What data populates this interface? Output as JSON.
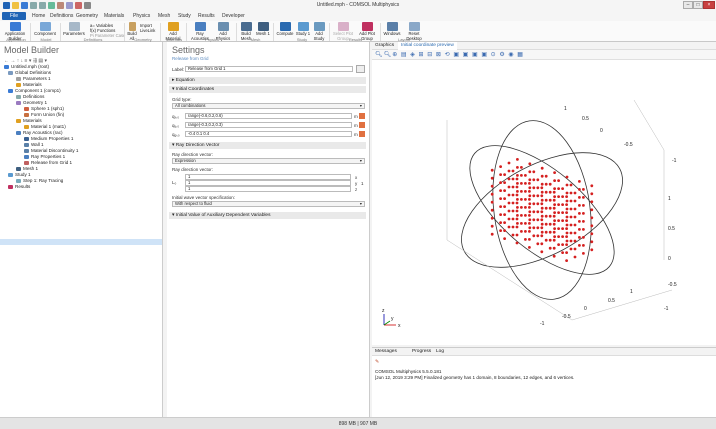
{
  "window": {
    "title": "Untitled.mph - COMSOL Multiphysics"
  },
  "menu": {
    "file": "File",
    "tabs": [
      "Home",
      "Definitions",
      "Geometry",
      "Materials",
      "Physics",
      "Mesh",
      "Study",
      "Results",
      "Developer"
    ]
  },
  "ribbon": {
    "application_builder": "Application Builder",
    "component": "Component",
    "parameters": "Parameters",
    "variables": "a= Variables",
    "functions": "f(x) Functions",
    "parameter_case": "Pi Parameter Case",
    "build_all": "Build All",
    "import": "Import",
    "livelink": "LiveLink",
    "add_material": "Add Material",
    "ray_acoustics": "Ray Acoustics",
    "add_physics": "Add Physics",
    "build_mesh": "Build Mesh",
    "mesh1": "Mesh 1",
    "compute": "Compute",
    "study1": "Study 1",
    "add_study": "Add Study",
    "select_plot_group": "Select Plot Group",
    "add_plot_group": "Add Plot Group",
    "windows": "Windows",
    "reset_desktop": "Reset Desktop",
    "groups": [
      "Application",
      "Model",
      "Definitions",
      "Geometry",
      "Materials",
      "Physics",
      "Mesh",
      "Study",
      "Results",
      "Layout"
    ]
  },
  "model_builder": {
    "title": "Model Builder",
    "tree": [
      "Untitled.mph (root)",
      "Global Definitions",
      "Parameters 1",
      "Materials",
      "Component 1 (comp1)",
      "Definitions",
      "Geometry 1",
      "Sphere 1 (sph1)",
      "Form Union (fin)",
      "Materials",
      "Material 1 (mat1)",
      "Ray Acoustics (rac)",
      "Medium Properties 1",
      "Wall 1",
      "Material Discontinuity 1",
      "Ray Properties 1",
      "Release from Grid 1",
      "Mesh 1",
      "Study 1",
      "Step 1: Ray Tracing",
      "Results"
    ]
  },
  "settings": {
    "title": "Settings",
    "subtitle": "Release from Grid",
    "label_caption": "Label:",
    "label_value": "Release from Grid 1",
    "equation": "Equation",
    "initial_coordinates": "Initial Coordinates",
    "grid_type_label": "Grid type:",
    "grid_type_value": "All combinations",
    "q_rows": [
      {
        "sym": "qₓ,₀",
        "val": "range(-0.6,0.2,0.6)",
        "unit": "m"
      },
      {
        "sym": "qᵧ,₀",
        "val": "range(-0.3,0.2,0.3)",
        "unit": "m"
      },
      {
        "sym": "qᵩ,₀",
        "val": "-0.4 0.1 0.4",
        "unit": "m"
      }
    ],
    "ray_direction": "Ray Direction Vector",
    "ray_direction_spec_label": "Ray direction vector:",
    "ray_direction_spec": "Expression",
    "ray_direction_label": "Ray direction vector:",
    "vector_symbol": "L₀",
    "vector_rows": [
      {
        "val": "1",
        "comp": "x"
      },
      {
        "val": "1",
        "comp": "y"
      },
      {
        "val": "1",
        "comp": "z"
      }
    ],
    "vector_unit": "1",
    "wave_spec_label": "Initial wave vector specification:",
    "wave_spec": "With respect to fluid",
    "aux": "Initial Value of Auxiliary Dependent Variables"
  },
  "graphics": {
    "tab": "Graphics",
    "preview_tab": "Initial coordinate preview",
    "axis_labels": [
      "1",
      "0.5",
      "0",
      "-0.5",
      "-1",
      "1",
      "0.5",
      "0",
      "-0.5",
      "-1",
      "-1",
      "-0.5",
      "0",
      "0.5",
      "1"
    ],
    "triad": {
      "x": "x",
      "y": "y",
      "z": "z"
    }
  },
  "messages": {
    "tabs": [
      "Messages",
      "Progress",
      "Log"
    ],
    "line1": "COMSOL Multiphysics 5.5.0.181",
    "line2": "[Jun 12, 2019 3:29 PM] Finalized geometry has 1 domain, 8 boundaries, 12 edges, and 6 vertices."
  },
  "status": {
    "memory": "898 MB | 907 MB"
  },
  "colors": {
    "file_blue": "#1e63b5",
    "point_red": "#d52020",
    "selected_row": "#cfe3f7"
  }
}
